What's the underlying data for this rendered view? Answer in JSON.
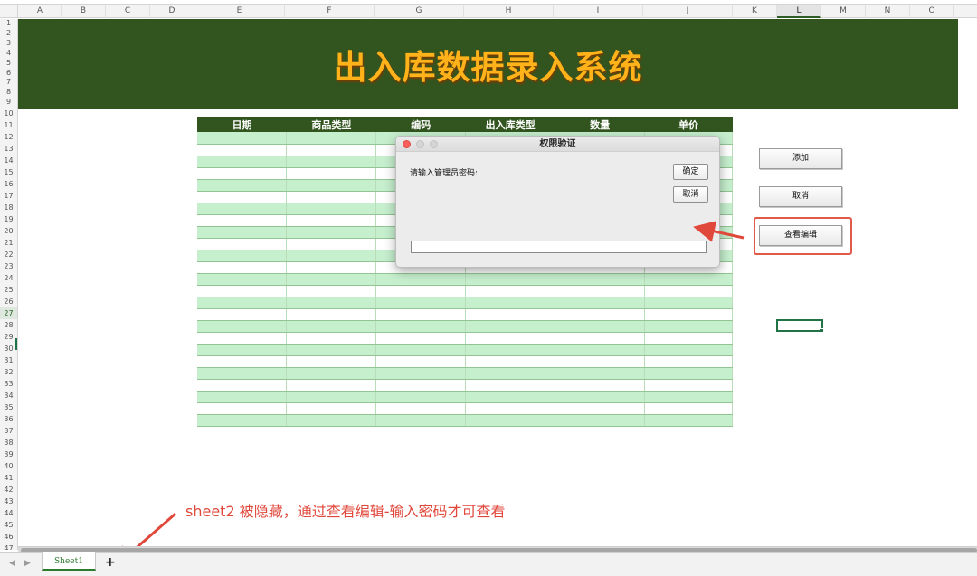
{
  "columns": [
    "A",
    "B",
    "C",
    "D",
    "E",
    "F",
    "G",
    "H",
    "I",
    "J",
    "K",
    "L",
    "M",
    "N",
    "O"
  ],
  "active_column": "L",
  "rows": [
    "1",
    "2",
    "3",
    "4",
    "5",
    "6",
    "7",
    "8",
    "9",
    "10",
    "11",
    "12",
    "13",
    "14",
    "15",
    "16",
    "17",
    "18",
    "19",
    "20",
    "21",
    "22",
    "23",
    "24",
    "25",
    "26",
    "27",
    "28",
    "29",
    "30",
    "31",
    "32",
    "33",
    "34",
    "35",
    "36",
    "37",
    "38",
    "39",
    "40",
    "41",
    "42",
    "43",
    "44",
    "45",
    "46",
    "47"
  ],
  "active_row": "27",
  "banner": {
    "title": "出入库数据录入系统"
  },
  "table": {
    "headers": [
      "日期",
      "商品类型",
      "编码",
      "出入库类型",
      "数量",
      "单价"
    ],
    "row_count": 25
  },
  "side_buttons": {
    "add": "添加",
    "cancel": "取消",
    "view_edit": "查看编辑"
  },
  "dialog": {
    "title": "权限验证",
    "prompt": "请输入管理员密码:",
    "ok": "确定",
    "cancel": "取消",
    "password_value": ""
  },
  "annotation": {
    "text": "sheet2 被隐藏，通过查看编辑-输入密码才可查看"
  },
  "sheet_tabs": [
    {
      "label": "Sheet1",
      "active": true
    }
  ],
  "add_sheet_label": "+",
  "colors": {
    "banner_bg": "#32551f",
    "banner_title": "#ffb21a",
    "row_stripe": "#c6efce",
    "annotation": "#e0483b",
    "selection": "#217346"
  }
}
